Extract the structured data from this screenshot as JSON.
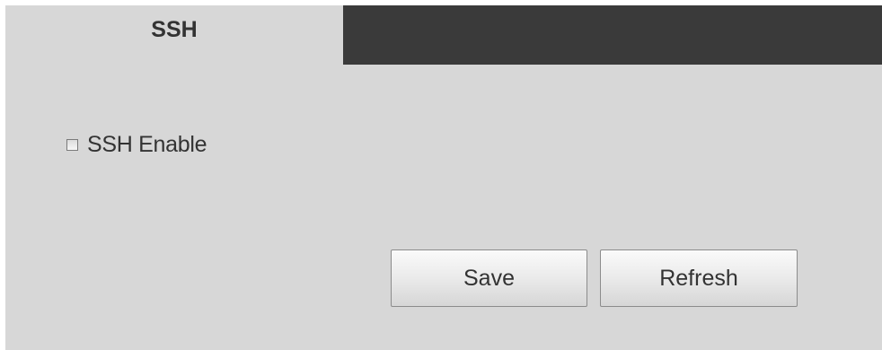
{
  "tabs": {
    "active_label": "SSH"
  },
  "ssh": {
    "enable_label": "SSH Enable",
    "enabled": false
  },
  "buttons": {
    "save_label": "Save",
    "refresh_label": "Refresh"
  },
  "colors": {
    "panel_background": "#d7d7d7",
    "tab_strip_background": "#3a3a3a",
    "text": "#333333"
  }
}
